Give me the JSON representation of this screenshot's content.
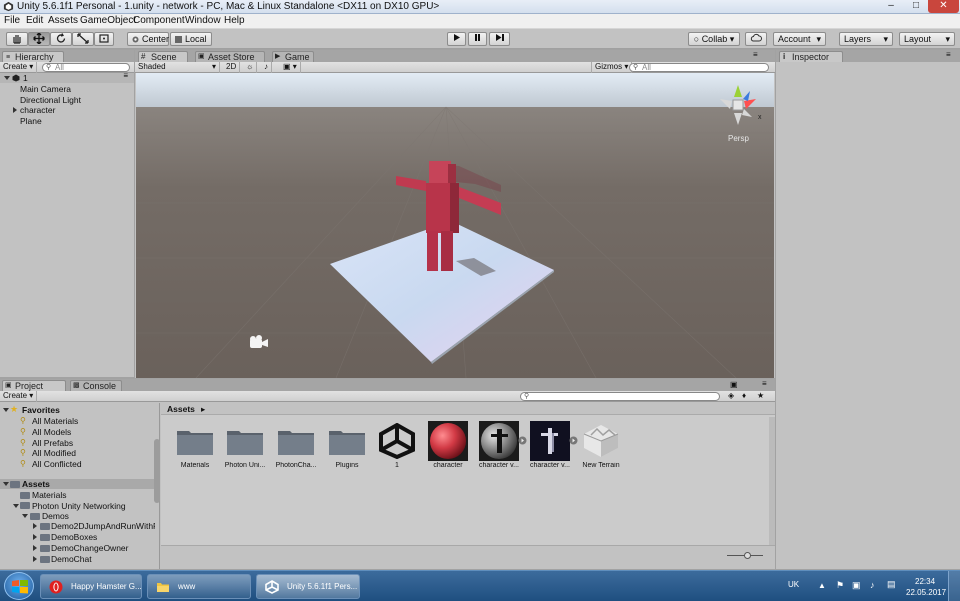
{
  "window": {
    "title": "Unity 5.6.1f1 Personal - 1.unity - network - PC, Mac & Linux Standalone <DX11 on DX10 GPU>"
  },
  "menu": [
    "File",
    "Edit",
    "Assets",
    "GameObject",
    "Component",
    "Window",
    "Help"
  ],
  "toolbar": {
    "pivot": "Center",
    "space": "Local",
    "collab": "Collab",
    "account": "Account",
    "layers": "Layers",
    "layout": "Layout"
  },
  "hierarchy": {
    "tab": "Hierarchy",
    "create": "Create",
    "search_placeholder": "All",
    "scene": "1",
    "items": [
      "Main Camera",
      "Directional Light",
      "character",
      "Plane"
    ]
  },
  "scene_view": {
    "tabs": [
      "Scene",
      "Asset Store",
      "Game"
    ],
    "shading": "Shaded",
    "mode2d": "2D",
    "gizmos": "Gizmos",
    "search_placeholder": "All",
    "persp": "Persp",
    "gizmo_axes": {
      "x": "x"
    },
    "colors": {
      "sky": "#dfe9f3",
      "ground": "#6f6660",
      "character": "#b8344a"
    }
  },
  "inspector": {
    "tab": "Inspector"
  },
  "project": {
    "tabs": [
      "Project",
      "Console"
    ],
    "create": "Create",
    "favorites_title": "Favorites",
    "favorites": [
      "All Materials",
      "All Models",
      "All Prefabs",
      "All Modified",
      "All Conflicted"
    ],
    "assets_title": "Assets",
    "assets_tree": [
      "Materials",
      "Photon Unity Networking"
    ],
    "demos_title": "Demos",
    "demos": [
      "Demo2DJumpAndRunWithF",
      "DemoBoxes",
      "DemoChangeOwner",
      "DemoChat"
    ],
    "breadcrumb": "Assets",
    "assets": [
      {
        "name": "Materials",
        "type": "folder"
      },
      {
        "name": "Photon Uni...",
        "type": "folder"
      },
      {
        "name": "PhotonCha...",
        "type": "folder"
      },
      {
        "name": "Plugins",
        "type": "folder"
      },
      {
        "name": "1",
        "type": "unity"
      },
      {
        "name": "character",
        "type": "material"
      },
      {
        "name": "character v...",
        "type": "model"
      },
      {
        "name": "character v...",
        "type": "prefab"
      },
      {
        "name": "New Terrain",
        "type": "terrain"
      }
    ]
  },
  "taskbar": {
    "items": [
      {
        "label": "Happy Hamster G...",
        "icon": "opera-icon"
      },
      {
        "label": "www",
        "icon": "folder-icon"
      },
      {
        "label": "Unity 5.6.1f1 Pers...",
        "icon": "unity-icon"
      }
    ],
    "lang": "UK",
    "time": "22:34",
    "date": "22.05.2017"
  }
}
